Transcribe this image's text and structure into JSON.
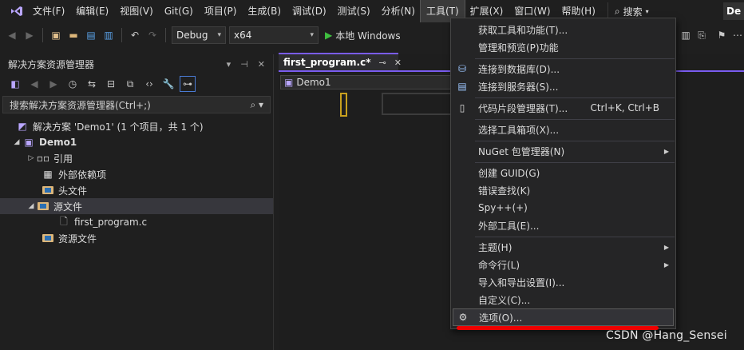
{
  "menubar": {
    "items": [
      "文件(F)",
      "编辑(E)",
      "视图(V)",
      "Git(G)",
      "项目(P)",
      "生成(B)",
      "调试(D)",
      "测试(S)",
      "分析(N)",
      "工具(T)",
      "扩展(X)",
      "窗口(W)",
      "帮助(H)"
    ],
    "active_item": "工具(T)",
    "search_label": "搜索",
    "title_chip": "De"
  },
  "toolbar": {
    "config": "Debug",
    "platform": "x64",
    "run_label": "本地 Windows"
  },
  "solution_explorer": {
    "title": "解决方案资源管理器",
    "search_placeholder": "搜索解决方案资源管理器(Ctrl+;)",
    "tree": [
      {
        "label": "解决方案 'Demo1' (1 个项目，共 1 个)"
      },
      {
        "label": "Demo1"
      },
      {
        "label": "引用"
      },
      {
        "label": "外部依赖项"
      },
      {
        "label": "头文件"
      },
      {
        "label": "源文件"
      },
      {
        "label": "first_program.c"
      },
      {
        "label": "资源文件"
      }
    ]
  },
  "editor": {
    "tab_label": "first_program.c*",
    "navbar_project": "Demo1"
  },
  "tools_menu": {
    "items": [
      {
        "label": "获取工具和功能(T)...",
        "shortcut": "",
        "submenu": false
      },
      {
        "label": "管理和预览(P)功能",
        "shortcut": "",
        "submenu": false
      },
      {
        "label": "连接到数据库(D)...",
        "shortcut": "",
        "submenu": false
      },
      {
        "label": "连接到服务器(S)...",
        "shortcut": "",
        "submenu": false
      },
      {
        "label": "代码片段管理器(T)...",
        "shortcut": "Ctrl+K, Ctrl+B",
        "submenu": false
      },
      {
        "label": "选择工具箱项(X)...",
        "shortcut": "",
        "submenu": false
      },
      {
        "label": "NuGet 包管理器(N)",
        "shortcut": "",
        "submenu": true
      },
      {
        "label": "创建 GUID(G)",
        "shortcut": "",
        "submenu": false
      },
      {
        "label": "错误查找(K)",
        "shortcut": "",
        "submenu": false
      },
      {
        "label": "Spy++(+)",
        "shortcut": "",
        "submenu": false
      },
      {
        "label": "外部工具(E)...",
        "shortcut": "",
        "submenu": false
      },
      {
        "label": "主题(H)",
        "shortcut": "",
        "submenu": true
      },
      {
        "label": "命令行(L)",
        "shortcut": "",
        "submenu": true
      },
      {
        "label": "导入和导出设置(I)...",
        "shortcut": "",
        "submenu": false
      },
      {
        "label": "自定义(C)...",
        "shortcut": "",
        "submenu": false
      },
      {
        "label": "选项(O)...",
        "shortcut": "",
        "submenu": false
      }
    ],
    "highlighted_item": "选项(O)..."
  },
  "watermark": "CSDN @Hang_Sensei",
  "colors": {
    "accent": "#7a5cf0",
    "annotation_red": "#e00000",
    "background": "#1f1f1f",
    "menu_bg": "#252526"
  }
}
